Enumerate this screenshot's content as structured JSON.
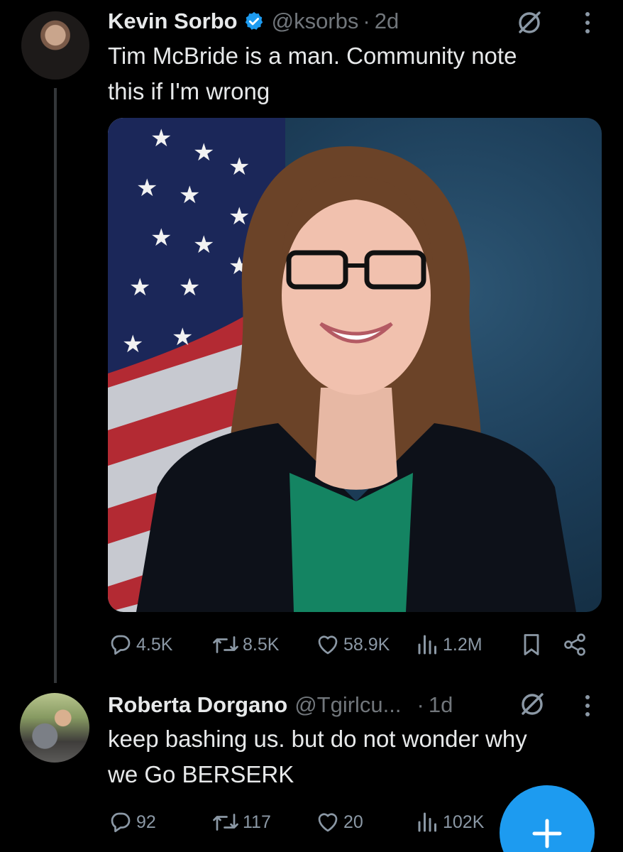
{
  "tweets": [
    {
      "author": "Kevin Sorbo",
      "handle": "@ksorbs",
      "separator": "·",
      "time": "2d",
      "text": "Tim McBride is a man. Community note\nthis if I'm wrong",
      "stats": {
        "replies": "4.5K",
        "reposts": "8.5K",
        "likes": "58.9K",
        "views": "1.2M"
      }
    },
    {
      "author": "Roberta Dorgano",
      "handle": "@Tgirlcu...",
      "separator": "·",
      "time": "1d",
      "text": "keep bashing us. but do not wonder why\nwe Go BERSERK",
      "stats": {
        "replies": "92",
        "reposts": "117",
        "likes": "20",
        "views": "102K"
      }
    }
  ],
  "colors": {
    "accent": "#1d9bf0",
    "muted": "#71767b",
    "text": "#e7e9ea",
    "background": "#000000"
  },
  "icons": [
    "verified-badge-icon",
    "grok-slash-icon",
    "more-vertical-icon",
    "reply-icon",
    "repost-icon",
    "like-icon",
    "views-icon",
    "bookmark-icon",
    "share-icon",
    "plus-icon"
  ]
}
